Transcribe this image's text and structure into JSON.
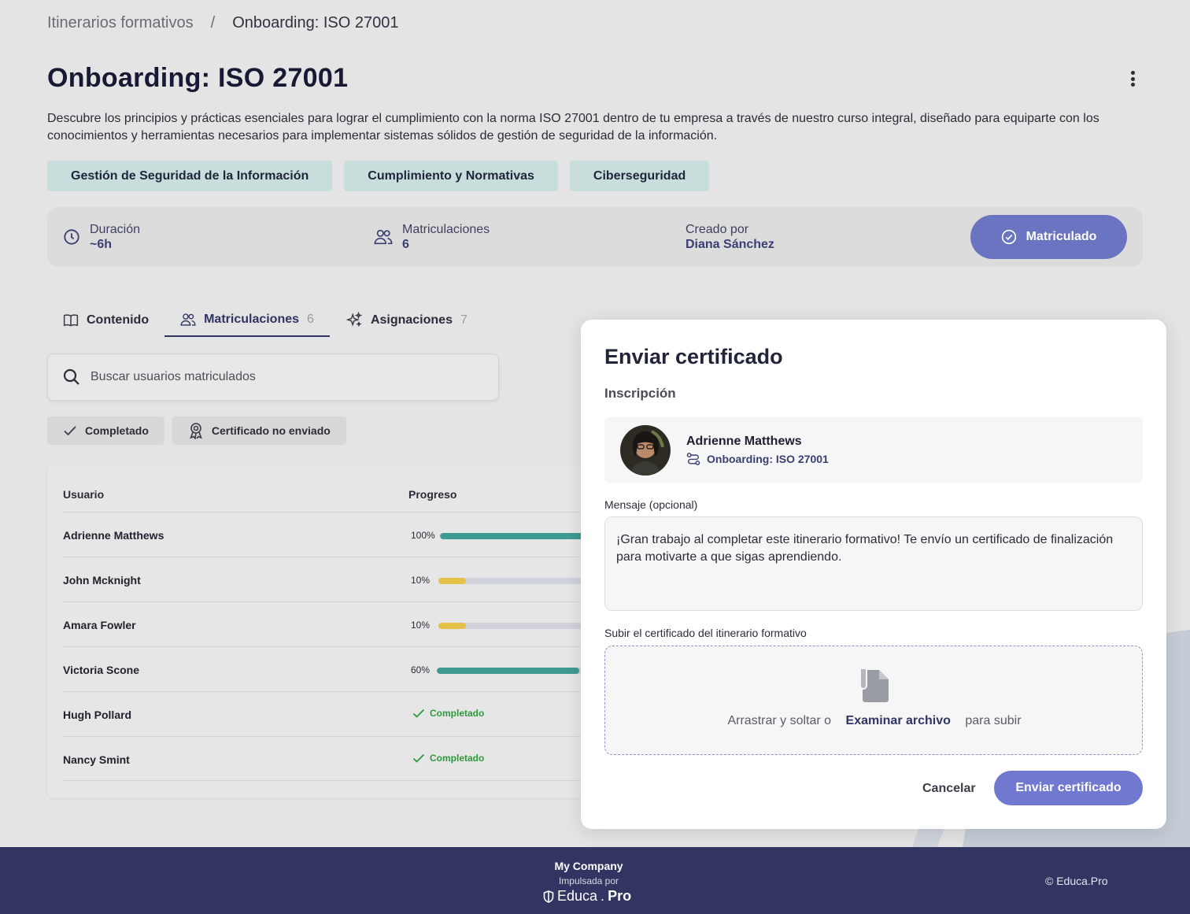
{
  "breadcrumb": {
    "parent": "Itinerarios formativos",
    "separator": "/",
    "current": "Onboarding: ISO 27001"
  },
  "page": {
    "title": "Onboarding: ISO 27001",
    "description": "Descubre los principios y prácticas esenciales para lograr el cumplimiento con la norma ISO 27001 dentro de tu empresa a través de nuestro curso integral, diseñado para equiparte con los conocimientos y herramientas necesarios para implementar sistemas sólidos de gestión de seguridad de la información."
  },
  "tags": [
    "Gestión de Seguridad de la Información",
    "Cumplimiento y Normativas",
    "Ciberseguridad"
  ],
  "info": {
    "duration_label": "Duración",
    "duration_value": "~6h",
    "enrollments_label": "Matriculaciones",
    "enrollments_value": "6",
    "creator_label": "Creado por",
    "creator_value": "Diana Sánchez",
    "enrolled_button": "Matriculado"
  },
  "tabs": [
    {
      "label": "Contenido",
      "count": ""
    },
    {
      "label": "Matriculaciones",
      "count": "6"
    },
    {
      "label": "Asignaciones",
      "count": "7"
    }
  ],
  "search": {
    "placeholder": "Buscar usuarios matriculados"
  },
  "filters": [
    "Completado",
    "Certificado no enviado"
  ],
  "table": {
    "col_user": "Usuario",
    "col_progress": "Progreso",
    "rows": [
      {
        "name": "Adrienne Matthews",
        "progress_label": "100%",
        "progress": 100,
        "status": ""
      },
      {
        "name": "John Mcknight",
        "progress_label": "10%",
        "progress": 10,
        "status": ""
      },
      {
        "name": "Amara Fowler",
        "progress_label": "10%",
        "progress": 10,
        "status": ""
      },
      {
        "name": "Victoria Scone",
        "progress_label": "60%",
        "progress": 60,
        "status": ""
      },
      {
        "name": "Hugh Pollard",
        "progress_label": "",
        "progress": 100,
        "status": "Completado"
      },
      {
        "name": "Nancy Smint",
        "progress_label": "",
        "progress": 100,
        "status": "Completado"
      }
    ]
  },
  "modal": {
    "title": "Enviar certificado",
    "subtitle": "Inscripción",
    "enrollee_name": "Adrienne Matthews",
    "enrollee_path": "Onboarding: ISO 27001",
    "message_label": "Mensaje (opcional)",
    "message_value": "¡Gran trabajo al completar este itinerario formativo! Te envío un certificado de finalización para motivarte a que sigas aprendiendo.",
    "upload_label": "Subir el certificado del itinerario formativo",
    "drop_text_before": "Arrastrar y soltar o",
    "drop_link": "Examinar archivo",
    "drop_text_after": "para subir",
    "cancel_button": "Cancelar",
    "send_button": "Enviar certificado"
  },
  "footer": {
    "company": "My Company",
    "powered_by": "Impulsada por",
    "logo_left": "Educa",
    "logo_dot": ".",
    "logo_right": "Pro",
    "copyright": "© Educa.Pro"
  },
  "colors": {
    "accent": "#6b74c0",
    "progress_high": "#3e9b94",
    "progress_low": "#e6c14a",
    "success": "#2d9a3a",
    "footer": "#323562"
  },
  "icons": {
    "duration": "clock-icon",
    "enrollments": "users-icon",
    "enrolled": "check-circle-icon",
    "tab_content": "book-icon",
    "tab_enrollments": "users-icon",
    "tab_assignments": "sparkles-icon",
    "search": "search-icon",
    "filter_completed": "check-icon",
    "filter_certificate": "award-icon",
    "path": "route-icon",
    "upload": "file-icon",
    "more": "kebab-menu-icon"
  }
}
